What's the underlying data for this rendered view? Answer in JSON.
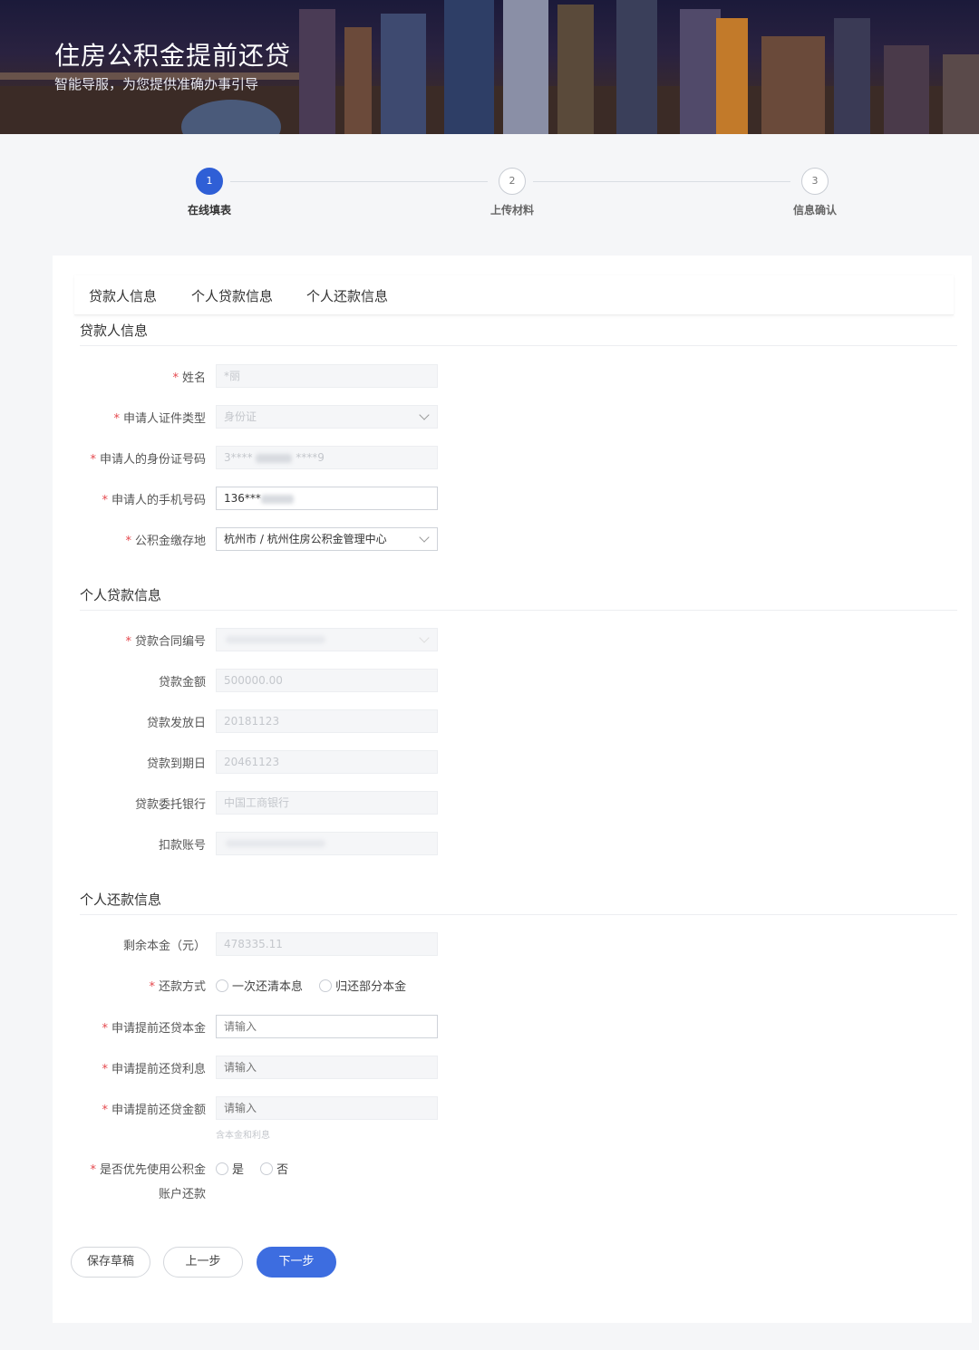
{
  "banner": {
    "title": "住房公积金提前还贷",
    "subtitle": "智能导服，为您提供准确办事引导"
  },
  "steps": [
    {
      "number": "1",
      "label": "在线填表",
      "active": true
    },
    {
      "number": "2",
      "label": "上传材料",
      "active": false
    },
    {
      "number": "3",
      "label": "信息确认",
      "active": false
    }
  ],
  "tabs": [
    "贷款人信息",
    "个人贷款信息",
    "个人还款信息"
  ],
  "sections": {
    "borrower": "贷款人信息",
    "loan": "个人贷款信息",
    "repay": "个人还款信息"
  },
  "borrower": {
    "name_label": "姓名",
    "name_value": "*丽",
    "id_type_label": "申请人证件类型",
    "id_type_value": "身份证",
    "id_no_label": "申请人的身份证号码",
    "id_no_value": "3****",
    "id_no_suffix": "****9",
    "phone_label": "申请人的手机号码",
    "phone_value": "136***",
    "fund_place_label": "公积金缴存地",
    "fund_place_value": "杭州市 / 杭州住房公积金管理中心"
  },
  "loan": {
    "contract_label": "贷款合同编号",
    "amount_label": "贷款金额",
    "amount_value": "500000.00",
    "issue_date_label": "贷款发放日",
    "issue_date_value": "20181123",
    "due_date_label": "贷款到期日",
    "due_date_value": "20461123",
    "bank_label": "贷款委托银行",
    "bank_value": "中国工商银行",
    "account_label": "扣款账号"
  },
  "repay": {
    "remaining_label": "剩余本金（元）",
    "remaining_value": "478335.11",
    "method_label": "还款方式",
    "method_options": [
      "一次还清本息",
      "归还部分本金"
    ],
    "principal_label": "申请提前还贷本金",
    "principal_placeholder": "请输入",
    "interest_label": "申请提前还贷利息",
    "interest_placeholder": "请输入",
    "total_label": "申请提前还贷金额",
    "total_placeholder": "请输入",
    "total_hint": "含本金和利息",
    "priority_label_1": "是否优先使用公积金",
    "priority_label_2": "账户还款",
    "priority_options": [
      "是",
      "否"
    ]
  },
  "buttons": {
    "save": "保存草稿",
    "prev": "上一步",
    "next": "下一步"
  },
  "required_mark": "*"
}
